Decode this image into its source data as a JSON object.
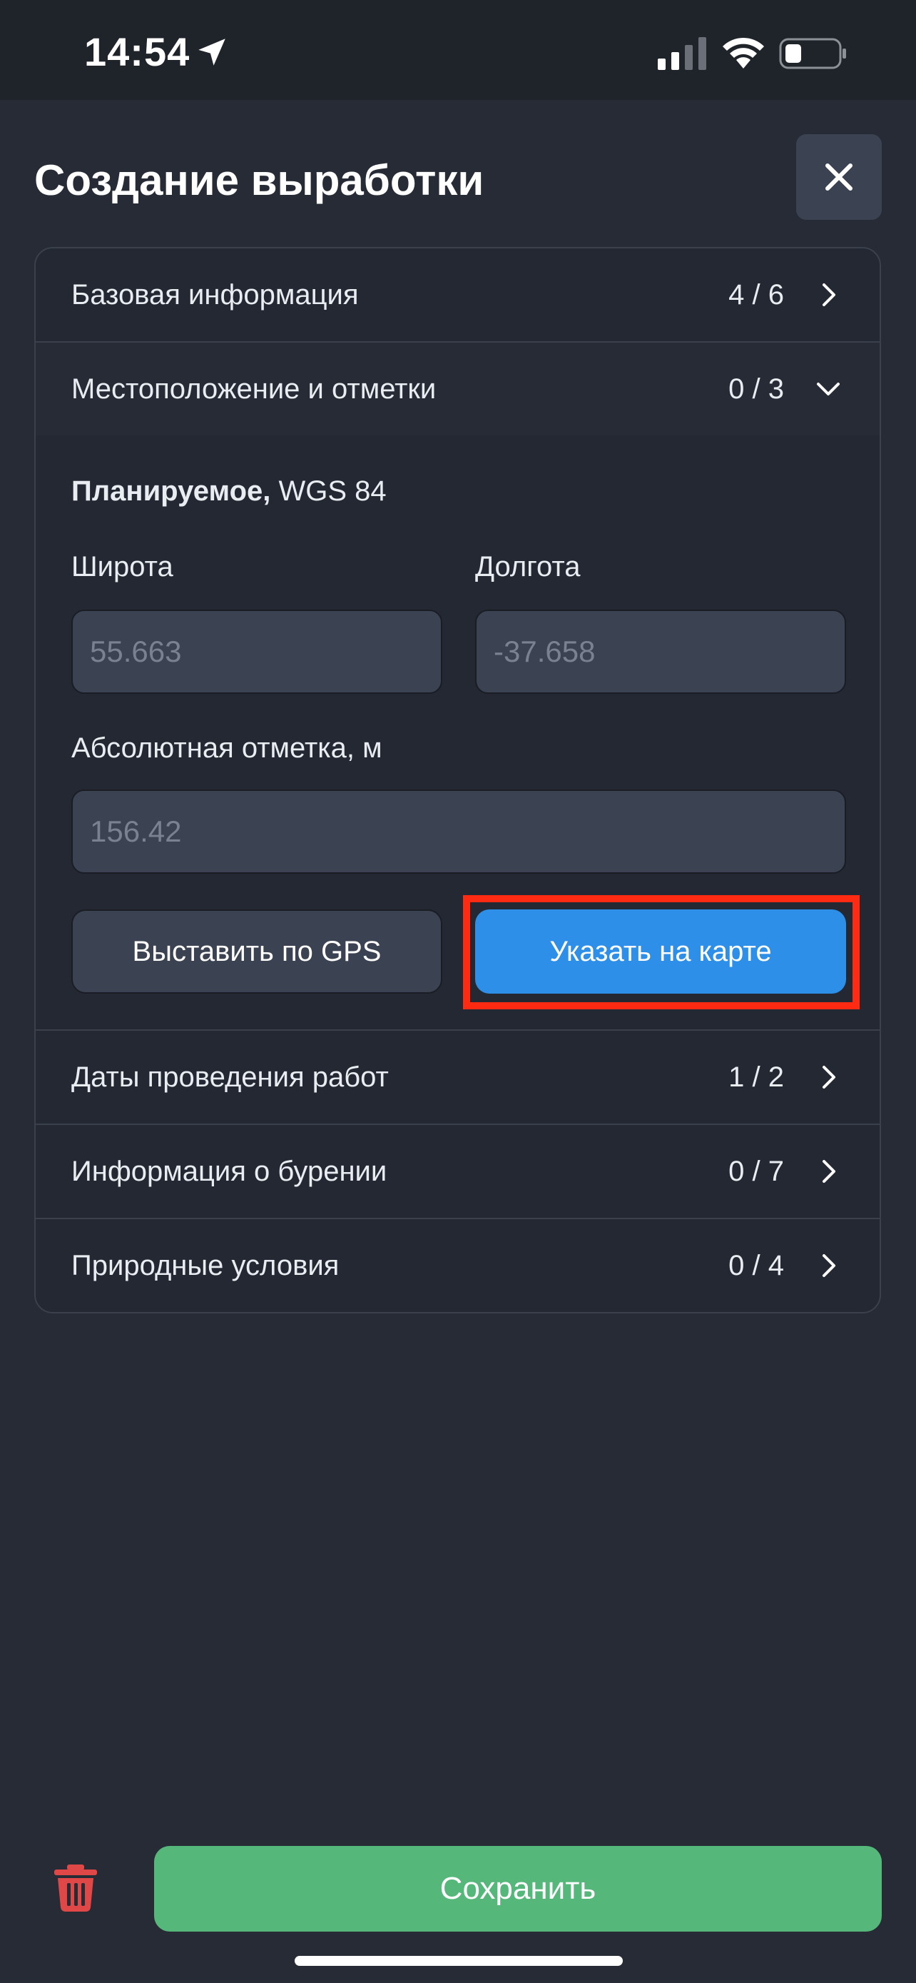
{
  "status_bar": {
    "time": "14:54",
    "icons": [
      "location-arrow-icon",
      "cellular-signal-icon",
      "wifi-icon",
      "battery-icon"
    ]
  },
  "header": {
    "title": "Создание выработки",
    "close_icon": "close-icon"
  },
  "sections": [
    {
      "label": "Базовая информация",
      "count": "4 / 6",
      "expanded": false
    },
    {
      "label": "Местоположение и отметки",
      "count": "0 / 3",
      "expanded": true
    },
    {
      "label": "Даты проведения работ",
      "count": "1 / 2",
      "expanded": false
    },
    {
      "label": "Информация о бурении",
      "count": "0 / 7",
      "expanded": false
    },
    {
      "label": "Природные условия",
      "count": "0 / 4",
      "expanded": false
    }
  ],
  "location": {
    "title_bold": "Планируемое,",
    "title_rest": " WGS 84",
    "latitude": {
      "label": "Широта",
      "placeholder": "55.663"
    },
    "longitude": {
      "label": "Долгота",
      "placeholder": "-37.658"
    },
    "elevation": {
      "label": "Абсолютная отметка, м",
      "placeholder": "156.42"
    },
    "gps_button": "Выставить по GPS",
    "map_button": "Указать на карте"
  },
  "footer": {
    "delete_icon": "trash-icon",
    "save_label": "Сохранить"
  },
  "colors": {
    "background": "#262b35",
    "primary_button": "#2d8fe8",
    "save_button": "#55b87a",
    "delete": "#e04848",
    "highlight": "#ff2a12"
  }
}
